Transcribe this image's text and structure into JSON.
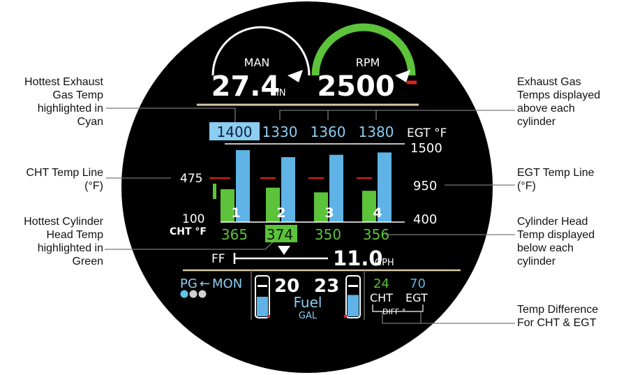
{
  "colors": {
    "background": "#000000",
    "cyan": "#5fb3e6",
    "cyan_highlight": "#8ccdf2",
    "green": "#5cc33a",
    "red": "#e0221b",
    "white": "#ffffff",
    "tan": "#d8c9a6"
  },
  "gauges": {
    "man": {
      "label": "MAN",
      "value": "27.4",
      "unit": "IN"
    },
    "rpm": {
      "label": "RPM",
      "value": "2500"
    }
  },
  "egt": {
    "unit_label": "EGT °F",
    "scale_top": "1500",
    "scale_mid": "950",
    "scale_bottom": "400",
    "values": [
      "1400",
      "1330",
      "1360",
      "1380"
    ],
    "bar_fractions": [
      0.92,
      0.83,
      0.86,
      0.89
    ],
    "hottest_index": 0
  },
  "cht": {
    "unit_label": "CHT °F",
    "scale_top": "475",
    "scale_bottom": "100",
    "values": [
      "365",
      "374",
      "350",
      "356"
    ],
    "bar_fractions": [
      0.42,
      0.44,
      0.38,
      0.4
    ],
    "hottest_index": 1
  },
  "cylinders": [
    "1",
    "2",
    "3",
    "4"
  ],
  "fuel_flow": {
    "label": "FF",
    "value": "11.0",
    "unit": "GPH"
  },
  "fuel": {
    "left": "20",
    "right": "23",
    "label": "Fuel",
    "unit": "GAL",
    "left_fraction": 0.55,
    "right_fraction": 0.6
  },
  "page_indicator": {
    "label": "PG",
    "arrow": "←",
    "mode": "MON"
  },
  "diff": {
    "cht_value": "24",
    "egt_value": "70",
    "cht_label": "CHT",
    "egt_label": "EGT",
    "diff_label": "DIFF °"
  },
  "callouts": {
    "hottest_egt": "Hottest Exhaust\nGas Temp\nhighlighted in\nCyan",
    "cht_temp_line": "CHT Temp Line\n(°F)",
    "hottest_cht": "Hottest Cylinder\nHead Temp\nhighlighted in\nGreen",
    "egt_above": "Exhaust Gas\nTemps displayed\nabove each\ncylinder",
    "egt_temp_line": "EGT Temp Line\n(°F)",
    "cht_below": "Cylinder Head\nTemp displayed\nbelow each\ncylinder",
    "temp_diff": "Temp Difference\nFor CHT & EGT"
  }
}
